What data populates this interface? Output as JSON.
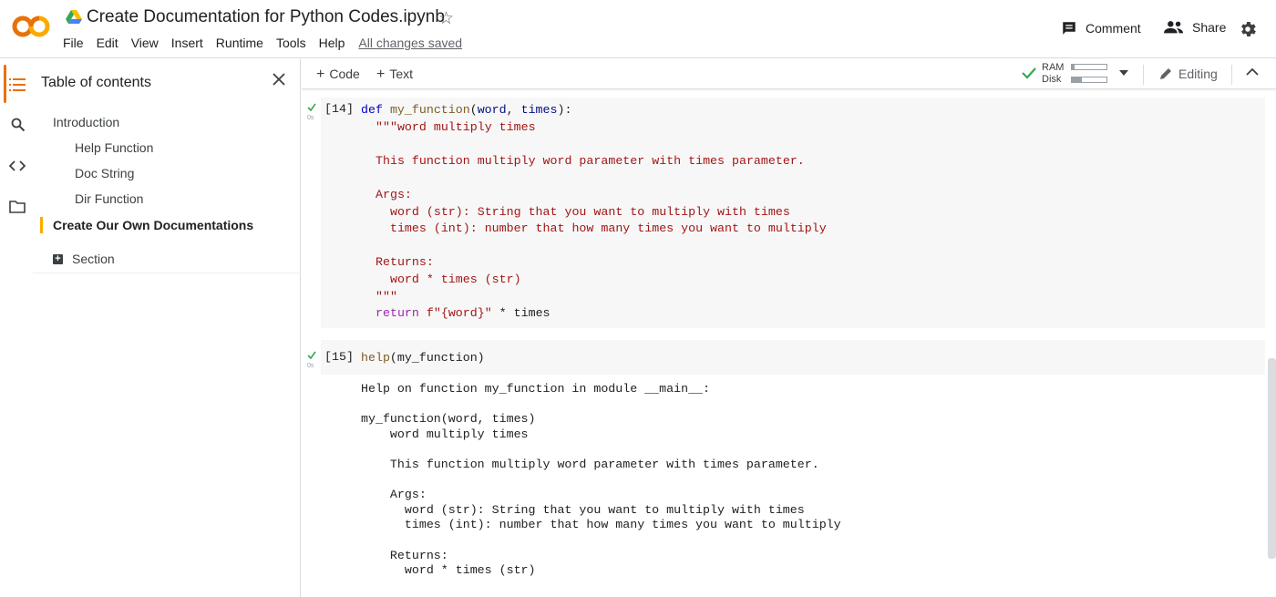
{
  "header": {
    "title": "Create Documentation for Python Codes.ipynb",
    "menu": [
      "File",
      "Edit",
      "View",
      "Insert",
      "Runtime",
      "Tools",
      "Help"
    ],
    "save_status": "All changes saved",
    "comment_label": "Comment",
    "share_label": "Share"
  },
  "toc": {
    "title": "Table of contents",
    "items": [
      {
        "label": "Introduction",
        "level": 1
      },
      {
        "label": "Help Function",
        "level": 2
      },
      {
        "label": "Doc String",
        "level": 2
      },
      {
        "label": "Dir Function",
        "level": 2
      },
      {
        "label": "Create Our Own Documentations",
        "level": 1,
        "active": true
      }
    ],
    "section_label": "Section"
  },
  "toolbar": {
    "add_code": "Code",
    "add_text": "Text",
    "ram_label": "RAM",
    "disk_label": "Disk",
    "ram_usage": 0.08,
    "disk_usage": 0.3,
    "editing_label": "Editing"
  },
  "cells": [
    {
      "exec_count": "[14]",
      "duration": "0s",
      "code": {
        "kw_def": "def",
        "fn_name": "my_function",
        "params_open": "(",
        "param_word": "word",
        "comma": ", ",
        "param_times": "times",
        "params_close": "):",
        "docstring": "\"\"\"word multiply times\n\nThis function multiply word parameter with times parameter.\n\nArgs:\n  word (str): String that you want to multiply with times\n  times (int): number that how many times you want to multiply\n\nReturns:\n  word * times (str)\n\"\"\"",
        "kw_return": "return",
        "fstring": "f\"{word}\"",
        "ret_rest": " * times"
      }
    },
    {
      "exec_count": "[15]",
      "duration": "0s",
      "code": {
        "fn_help": "help",
        "rest": "(my_function)"
      },
      "output": "Help on function my_function in module __main__:\n\nmy_function(word, times)\n    word multiply times\n\n    This function multiply word parameter with times parameter.\n\n    Args:\n      word (str): String that you want to multiply with times\n      times (int): number that how many times you want to multiply\n\n    Returns:\n      word * times (str)"
    }
  ],
  "colors": {
    "accent_orange": "#e8710a",
    "toc_active": "#f9ab00",
    "success_green": "#34a853"
  }
}
